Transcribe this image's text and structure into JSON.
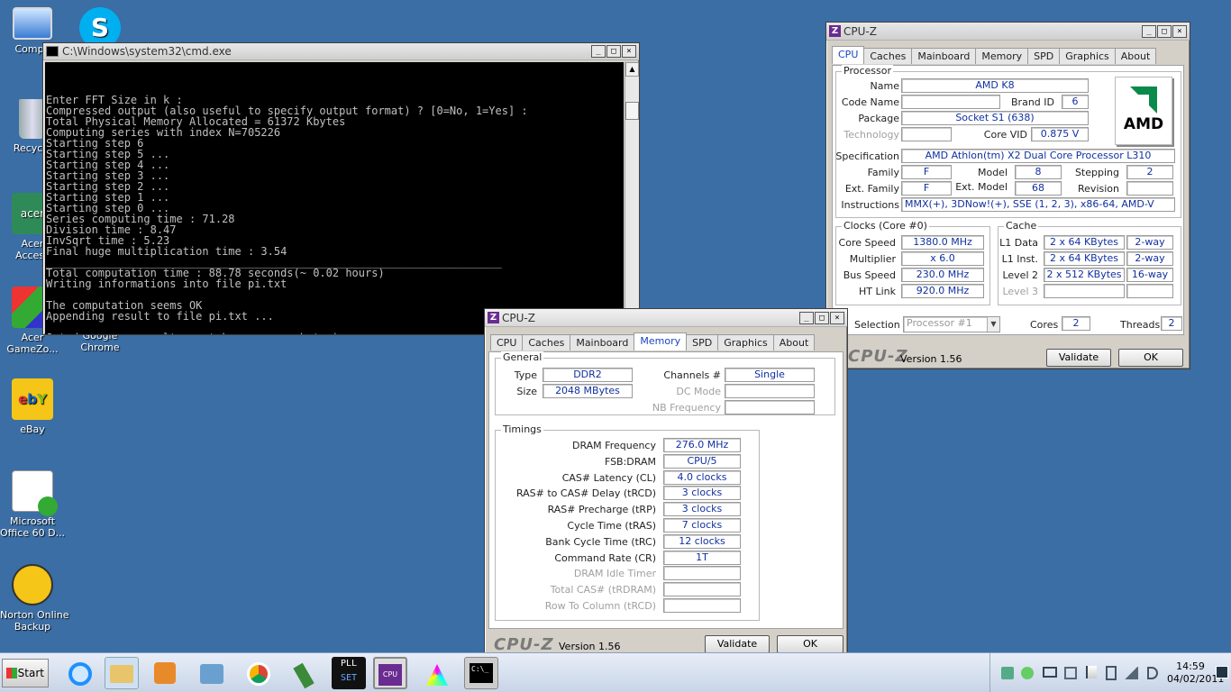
{
  "desktop": {
    "icons": [
      {
        "label": "Compu",
        "icon": "computer-icon"
      },
      {
        "label": "",
        "icon": "skype-icon"
      },
      {
        "label": "Recycle",
        "icon": "recycle-bin-icon"
      },
      {
        "label": "Acer\nAccess",
        "icon": "acer-icon"
      },
      {
        "label": "Acer\nGameZo...",
        "icon": "games-icon"
      },
      {
        "label": "Google\nChrome",
        "icon": "chrome-icon"
      },
      {
        "label": "eBay",
        "icon": "ebay-icon"
      },
      {
        "label": "Microsoft\nOffice 60 D...",
        "icon": "office-icon"
      },
      {
        "label": "Norton Online\nBackup",
        "icon": "norton-icon"
      }
    ]
  },
  "cmd": {
    "title": "C:\\Windows\\system32\\cmd.exe",
    "lines": [
      "Enter FFT Size in k :",
      "Compressed output (also useful to specify output format) ? [0=No, 1=Yes] :",
      "Total Physical Memory Allocated = 61372 Kbytes",
      "Computing series with index N=705226",
      "Starting step 6",
      "Starting step 5 ...",
      "Starting step 4 ...",
      "Starting step 3 ...",
      "Starting step 2 ...",
      "Starting step 1 ...",
      "Starting step 0 ...",
      "Series computing time : 71.28",
      "Division time : 8.47",
      "InvSqrt time : 5.23",
      "Final huge multiplication time : 3.54",
      "______________________________________________________________________",
      "Total computation time : 88.78 seconds(~ 0.02 hours)",
      "Writing informations into file pi.txt",
      "",
      "The computation seems OK",
      "Appending result to file pi.txt ...",
      "",
      "Jot down your results or take a screenshot :)",
      "Press any key to continue . . ."
    ]
  },
  "cpuz_cpu": {
    "title": "CPU-Z",
    "tabs": [
      "CPU",
      "Caches",
      "Mainboard",
      "Memory",
      "SPD",
      "Graphics",
      "About"
    ],
    "processor": {
      "group": "Processor",
      "name_label": "Name",
      "name": "AMD K8",
      "codename_label": "Code Name",
      "codename": "",
      "brandid_label": "Brand ID",
      "brandid": "6",
      "package_label": "Package",
      "package": "Socket S1 (638)",
      "technology_label": "Technology",
      "technology": "",
      "corevid_label": "Core VID",
      "corevid": "0.875 V",
      "spec_label": "Specification",
      "spec": "AMD Athlon(tm) X2 Dual Core Processor L310",
      "family_label": "Family",
      "family": "F",
      "model_label": "Model",
      "model": "8",
      "stepping_label": "Stepping",
      "stepping": "2",
      "extfamily_label": "Ext. Family",
      "extfamily": "F",
      "extmodel_label": "Ext. Model",
      "extmodel": "68",
      "revision_label": "Revision",
      "revision": "",
      "instr_label": "Instructions",
      "instr": "MMX(+), 3DNow!(+), SSE (1, 2, 3), x86-64, AMD-V",
      "logo": "AMD"
    },
    "clocks": {
      "group": "Clocks (Core #0)",
      "corespeed_label": "Core Speed",
      "corespeed": "1380.0 MHz",
      "multiplier_label": "Multiplier",
      "multiplier": "x 6.0",
      "busspeed_label": "Bus Speed",
      "busspeed": "230.0 MHz",
      "htlink_label": "HT Link",
      "htlink": "920.0 MHz"
    },
    "cache": {
      "group": "Cache",
      "l1d_label": "L1 Data",
      "l1d": "2 x 64 KBytes",
      "l1d_way": "2-way",
      "l1i_label": "L1 Inst.",
      "l1i": "2 x 64 KBytes",
      "l1i_way": "2-way",
      "l2_label": "Level 2",
      "l2": "2 x 512 KBytes",
      "l2_way": "16-way",
      "l3_label": "Level 3"
    },
    "selection_label": "Selection",
    "selection": "Processor #1",
    "cores_label": "Cores",
    "cores": "2",
    "threads_label": "Threads",
    "threads": "2",
    "brand": "CPU-Z",
    "version": "Version 1.56",
    "validate": "Validate",
    "ok": "OK"
  },
  "cpuz_mem": {
    "title": "CPU-Z",
    "tabs": [
      "CPU",
      "Caches",
      "Mainboard",
      "Memory",
      "SPD",
      "Graphics",
      "About"
    ],
    "general": {
      "group": "General",
      "type_label": "Type",
      "type": "DDR2",
      "size_label": "Size",
      "size": "2048 MBytes",
      "channels_label": "Channels #",
      "channels": "Single",
      "dcmode_label": "DC Mode",
      "nbfreq_label": "NB Frequency"
    },
    "timings": {
      "group": "Timings",
      "rows": [
        {
          "label": "DRAM Frequency",
          "value": "276.0 MHz",
          "dim": false
        },
        {
          "label": "FSB:DRAM",
          "value": "CPU/5",
          "dim": false
        },
        {
          "label": "CAS# Latency (CL)",
          "value": "4.0 clocks",
          "dim": false
        },
        {
          "label": "RAS# to CAS# Delay (tRCD)",
          "value": "3 clocks",
          "dim": false
        },
        {
          "label": "RAS# Precharge (tRP)",
          "value": "3 clocks",
          "dim": false
        },
        {
          "label": "Cycle Time (tRAS)",
          "value": "7 clocks",
          "dim": false
        },
        {
          "label": "Bank Cycle Time (tRC)",
          "value": "12 clocks",
          "dim": false
        },
        {
          "label": "Command Rate (CR)",
          "value": "1T",
          "dim": false
        },
        {
          "label": "DRAM Idle Timer",
          "value": "",
          "dim": true
        },
        {
          "label": "Total CAS# (tRDRAM)",
          "value": "",
          "dim": true
        },
        {
          "label": "Row To Column (tRCD)",
          "value": "",
          "dim": true
        }
      ]
    },
    "brand": "CPU-Z",
    "version": "Version 1.56",
    "validate": "Validate",
    "ok": "OK"
  },
  "taskbar": {
    "start": "Start",
    "time": "14:59",
    "date": "04/02/2011"
  }
}
